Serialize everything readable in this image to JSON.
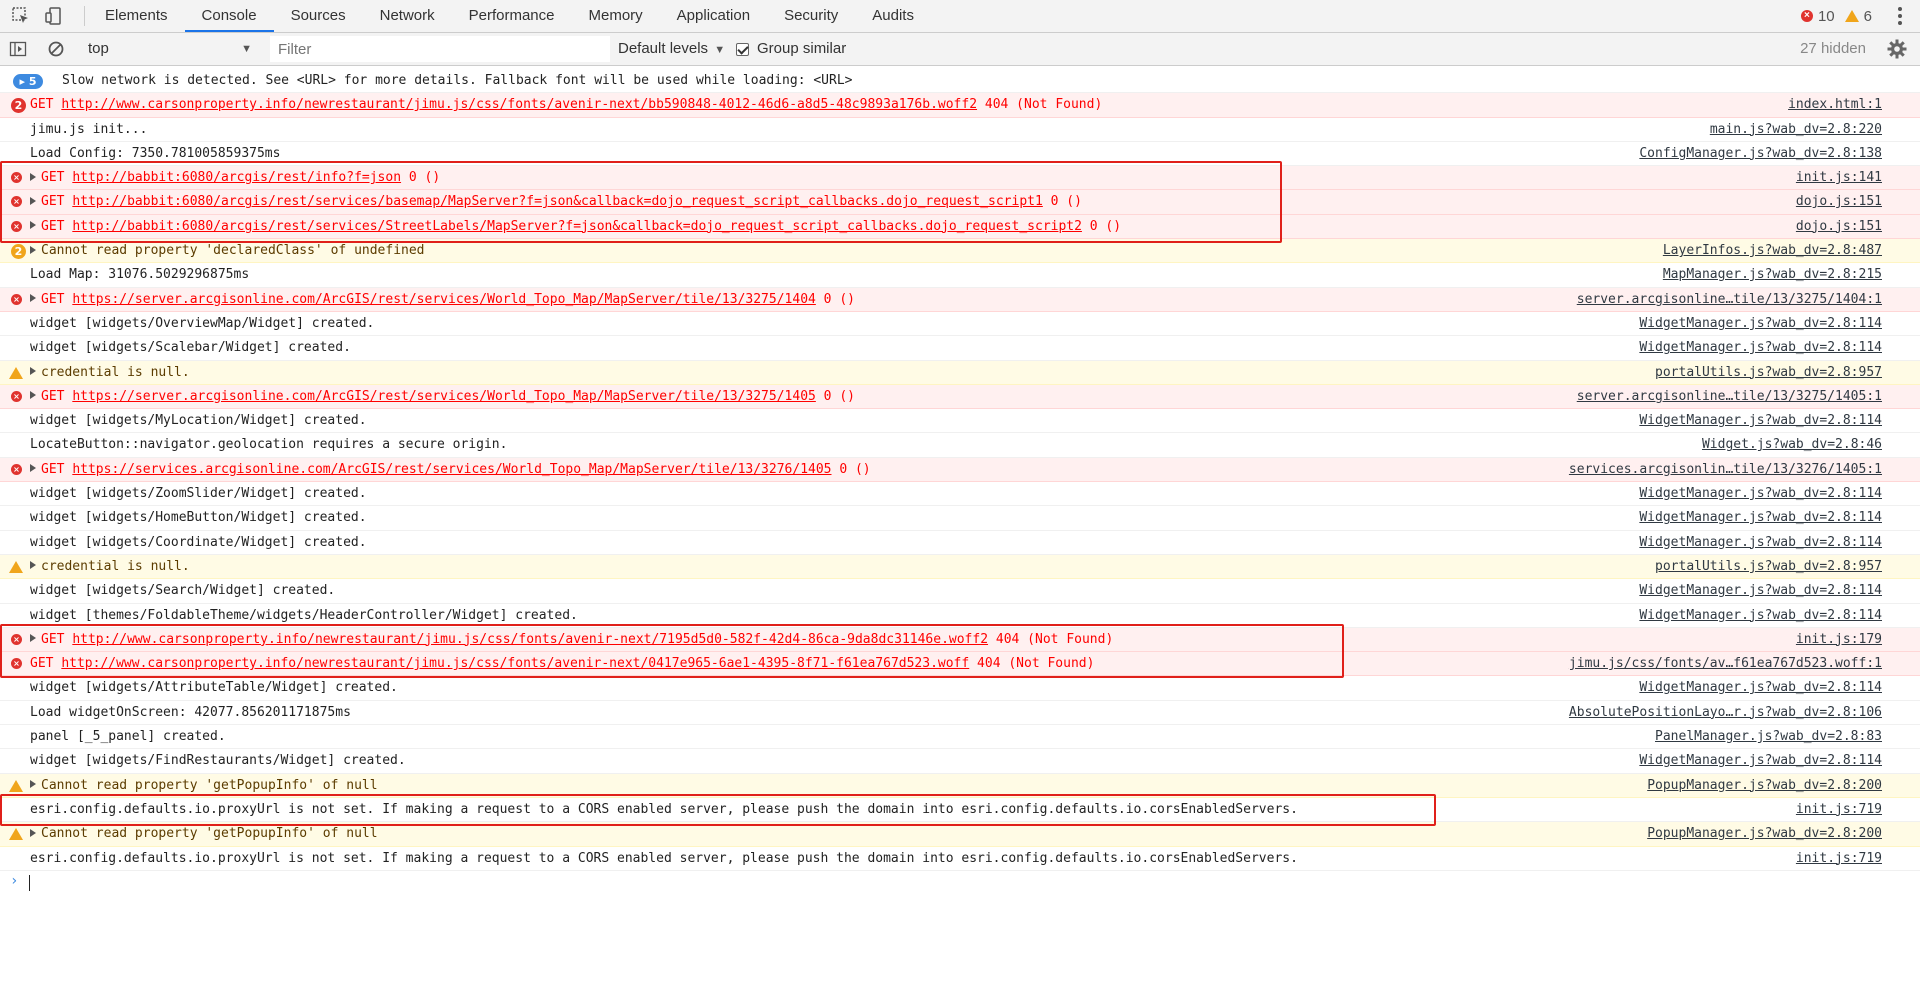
{
  "tabs": [
    "Elements",
    "Console",
    "Sources",
    "Network",
    "Performance",
    "Memory",
    "Application",
    "Security",
    "Audits"
  ],
  "active_tab": "Console",
  "counts": {
    "errors": "10",
    "warnings": "6"
  },
  "toolbar": {
    "context": "top",
    "filter_placeholder": "Filter",
    "levels": "Default levels",
    "group_similar": "Group similar",
    "hidden": "27 hidden"
  },
  "colors": {
    "error": "#e0332e",
    "warning": "#f0a51b",
    "info": "#3d8ae0",
    "highlight": "#e0201a"
  },
  "rows": [
    {
      "type": "info",
      "badge": "5",
      "expand": false,
      "pre": "Slow network is detected. See <URL> for more details. Fallback font will be used while loading: <URL>",
      "url": "",
      "post": "",
      "src": ""
    },
    {
      "type": "error",
      "badge": "2",
      "expand": false,
      "pre": "GET ",
      "url": "http://www.carsonproperty.info/newrestaurant/jimu.js/css/fonts/avenir-next/bb590848-4012-46d6-a8d5-48c9893a176b.woff2",
      "post": " 404 (Not Found)",
      "src": "index.html:1"
    },
    {
      "type": "log",
      "badge": "",
      "expand": false,
      "pre": "jimu.js init...",
      "url": "",
      "post": "",
      "src": "main.js?wab_dv=2.8:220"
    },
    {
      "type": "log",
      "badge": "",
      "expand": false,
      "pre": "Load Config: 7350.781005859375ms",
      "url": "",
      "post": "",
      "src": "ConfigManager.js?wab_dv=2.8:138"
    },
    {
      "type": "error",
      "badge": "",
      "expand": true,
      "pre": "GET ",
      "url": "http://babbit:6080/arcgis/rest/info?f=json",
      "post": " 0 ()",
      "src": "init.js:141"
    },
    {
      "type": "error",
      "badge": "",
      "expand": true,
      "pre": "GET ",
      "url": "http://babbit:6080/arcgis/rest/services/basemap/MapServer?f=json&callback=dojo_request_script_callbacks.dojo_request_script1",
      "post": " 0 ()",
      "src": "dojo.js:151"
    },
    {
      "type": "error",
      "badge": "",
      "expand": true,
      "pre": "GET ",
      "url": "http://babbit:6080/arcgis/rest/services/StreetLabels/MapServer?f=json&callback=dojo_request_script_callbacks.dojo_request_script2",
      "post": " 0 ()",
      "src": "dojo.js:151"
    },
    {
      "type": "warning",
      "badge": "2",
      "expand": true,
      "pre": "Cannot read property 'declaredClass' of undefined",
      "url": "",
      "post": "",
      "src": "LayerInfos.js?wab_dv=2.8:487"
    },
    {
      "type": "log",
      "badge": "",
      "expand": false,
      "pre": "Load Map: 31076.5029296875ms",
      "url": "",
      "post": "",
      "src": "MapManager.js?wab_dv=2.8:215"
    },
    {
      "type": "error",
      "badge": "",
      "expand": true,
      "pre": "GET ",
      "url": "https://server.arcgisonline.com/ArcGIS/rest/services/World_Topo_Map/MapServer/tile/13/3275/1404",
      "post": " 0 ()",
      "src": "server.arcgisonline…tile/13/3275/1404:1"
    },
    {
      "type": "log",
      "badge": "",
      "expand": false,
      "pre": "widget [widgets/OverviewMap/Widget] created.",
      "url": "",
      "post": "",
      "src": "WidgetManager.js?wab_dv=2.8:114"
    },
    {
      "type": "log",
      "badge": "",
      "expand": false,
      "pre": "widget [widgets/Scalebar/Widget] created.",
      "url": "",
      "post": "",
      "src": "WidgetManager.js?wab_dv=2.8:114"
    },
    {
      "type": "warning",
      "badge": "",
      "expand": true,
      "pre": "credential is null.",
      "url": "",
      "post": "",
      "src": "portalUtils.js?wab_dv=2.8:957"
    },
    {
      "type": "error",
      "badge": "",
      "expand": true,
      "pre": "GET ",
      "url": "https://server.arcgisonline.com/ArcGIS/rest/services/World_Topo_Map/MapServer/tile/13/3275/1405",
      "post": " 0 ()",
      "src": "server.arcgisonline…tile/13/3275/1405:1"
    },
    {
      "type": "log",
      "badge": "",
      "expand": false,
      "pre": "widget [widgets/MyLocation/Widget] created.",
      "url": "",
      "post": "",
      "src": "WidgetManager.js?wab_dv=2.8:114"
    },
    {
      "type": "log",
      "badge": "",
      "expand": false,
      "pre": "LocateButton::navigator.geolocation requires a secure origin.",
      "url": "",
      "post": "",
      "src": "Widget.js?wab_dv=2.8:46"
    },
    {
      "type": "error",
      "badge": "",
      "expand": true,
      "pre": "GET ",
      "url": "https://services.arcgisonline.com/ArcGIS/rest/services/World_Topo_Map/MapServer/tile/13/3276/1405",
      "post": " 0 ()",
      "src": "services.arcgisonlin…tile/13/3276/1405:1"
    },
    {
      "type": "log",
      "badge": "",
      "expand": false,
      "pre": "widget [widgets/ZoomSlider/Widget] created.",
      "url": "",
      "post": "",
      "src": "WidgetManager.js?wab_dv=2.8:114"
    },
    {
      "type": "log",
      "badge": "",
      "expand": false,
      "pre": "widget [widgets/HomeButton/Widget] created.",
      "url": "",
      "post": "",
      "src": "WidgetManager.js?wab_dv=2.8:114"
    },
    {
      "type": "log",
      "badge": "",
      "expand": false,
      "pre": "widget [widgets/Coordinate/Widget] created.",
      "url": "",
      "post": "",
      "src": "WidgetManager.js?wab_dv=2.8:114"
    },
    {
      "type": "warning",
      "badge": "",
      "expand": true,
      "pre": "credential is null.",
      "url": "",
      "post": "",
      "src": "portalUtils.js?wab_dv=2.8:957"
    },
    {
      "type": "log",
      "badge": "",
      "expand": false,
      "pre": "widget [widgets/Search/Widget] created.",
      "url": "",
      "post": "",
      "src": "WidgetManager.js?wab_dv=2.8:114"
    },
    {
      "type": "log",
      "badge": "",
      "expand": false,
      "pre": "widget [themes/FoldableTheme/widgets/HeaderController/Widget] created.",
      "url": "",
      "post": "",
      "src": "WidgetManager.js?wab_dv=2.8:114"
    },
    {
      "type": "error",
      "badge": "",
      "expand": true,
      "pre": "GET ",
      "url": "http://www.carsonproperty.info/newrestaurant/jimu.js/css/fonts/avenir-next/7195d5d0-582f-42d4-86ca-9da8dc31146e.woff2",
      "post": " 404 (Not Found)",
      "src": "init.js:179"
    },
    {
      "type": "error",
      "badge": "",
      "expand": false,
      "pre": "GET ",
      "url": "http://www.carsonproperty.info/newrestaurant/jimu.js/css/fonts/avenir-next/0417e965-6ae1-4395-8f71-f61ea767d523.woff",
      "post": " 404 (Not Found)",
      "src": "jimu.js/css/fonts/av…f61ea767d523.woff:1"
    },
    {
      "type": "log",
      "badge": "",
      "expand": false,
      "pre": "widget [widgets/AttributeTable/Widget] created.",
      "url": "",
      "post": "",
      "src": "WidgetManager.js?wab_dv=2.8:114"
    },
    {
      "type": "log",
      "badge": "",
      "expand": false,
      "pre": "Load widgetOnScreen: 42077.856201171875ms",
      "url": "",
      "post": "",
      "src": "AbsolutePositionLayo…r.js?wab_dv=2.8:106"
    },
    {
      "type": "log",
      "badge": "",
      "expand": false,
      "pre": "panel [_5_panel] created.",
      "url": "",
      "post": "",
      "src": "PanelManager.js?wab_dv=2.8:83"
    },
    {
      "type": "log",
      "badge": "",
      "expand": false,
      "pre": "widget [widgets/FindRestaurants/Widget] created.",
      "url": "",
      "post": "",
      "src": "WidgetManager.js?wab_dv=2.8:114"
    },
    {
      "type": "warning",
      "badge": "",
      "expand": true,
      "pre": "Cannot read property 'getPopupInfo' of null",
      "url": "",
      "post": "",
      "src": "PopupManager.js?wab_dv=2.8:200"
    },
    {
      "type": "log",
      "badge": "",
      "expand": false,
      "pre": "esri.config.defaults.io.proxyUrl is not set. If making a request to a CORS enabled server, please push the domain into esri.config.defaults.io.corsEnabledServers.",
      "url": "",
      "post": "",
      "src": "init.js:719"
    },
    {
      "type": "warning",
      "badge": "",
      "expand": true,
      "pre": "Cannot read property 'getPopupInfo' of null",
      "url": "",
      "post": "",
      "src": "PopupManager.js?wab_dv=2.8:200"
    },
    {
      "type": "log",
      "badge": "",
      "expand": false,
      "pre": "esri.config.defaults.io.proxyUrl is not set. If making a request to a CORS enabled server, please push the domain into esri.config.defaults.io.corsEnabledServers.",
      "url": "",
      "post": "",
      "src": "init.js:719"
    }
  ]
}
